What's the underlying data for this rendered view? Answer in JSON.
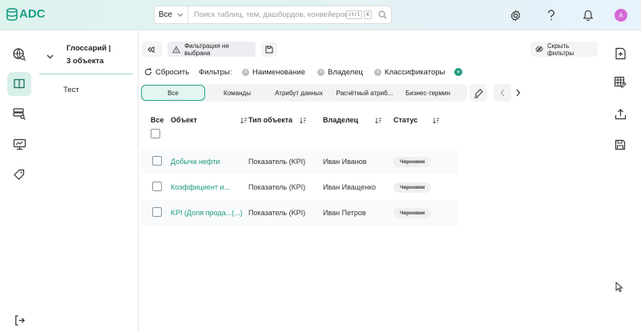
{
  "app": {
    "logo_text": "ADC"
  },
  "search": {
    "scope": "Все",
    "placeholder": "Поиск таблиц, тем, дашбордов, конвейеров, м...",
    "kbd_ctrl": "ctrl",
    "kbd_k": "K"
  },
  "user": {
    "avatar_letter": "A"
  },
  "tree": {
    "title_line1": "Глоссарий |",
    "title_line2": "3 объекта",
    "items": [
      "Тест"
    ]
  },
  "toolbar": {
    "filter_status": "Фильтрация не выбрана",
    "hide_filters": "Скрыть фильтры",
    "reset": "Сбросить",
    "filters_label": "Фильтры:",
    "filters": [
      "Наименование",
      "Владелец",
      "Классификаторы"
    ]
  },
  "tabs": [
    "Все",
    "Команды",
    "Атрибут данных",
    "Расчётный атриб...",
    "Бизнес-термин"
  ],
  "table": {
    "headers": {
      "all": "Все",
      "object": "Объект",
      "type": "Тип объекта",
      "owner": "Владелец",
      "status": "Статус"
    },
    "rows": [
      {
        "object": "Добыча нефти",
        "type": "Показатель (KPI)",
        "owner": "Иван Иванов",
        "status": "Черновик"
      },
      {
        "object": "Коэффициент и...",
        "type": "Показатель (KPI)",
        "owner": "Иван Иващенко",
        "status": "Черновик"
      },
      {
        "object": "KPI (Доля прода...(...)",
        "type": "Показатель (KPI)",
        "owner": "Иван Петров",
        "status": "Черновик"
      }
    ]
  },
  "colors": {
    "accent": "#1f9b81",
    "active_bg": "#d8f0ea"
  }
}
